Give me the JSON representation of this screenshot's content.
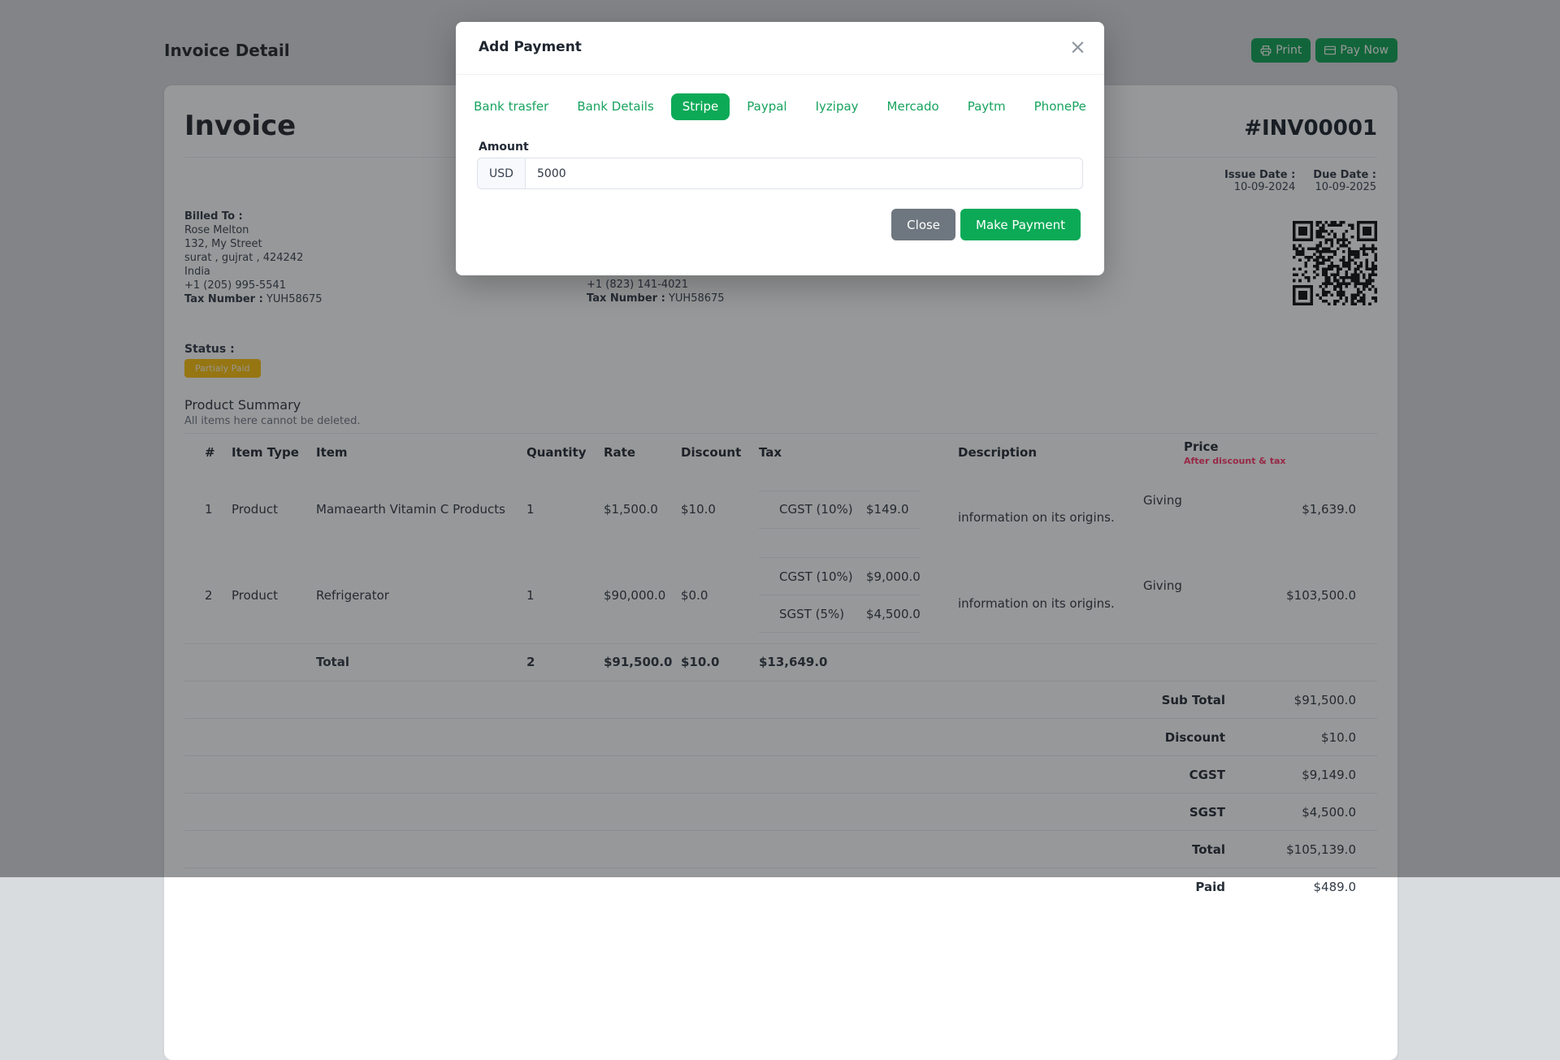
{
  "page": {
    "title": "Invoice Detail",
    "print_label": "Print",
    "pay_now_label": "Pay Now"
  },
  "invoice": {
    "heading": "Invoice",
    "number": "#INV00001",
    "billed_to": {
      "label": "Billed To :",
      "name": "Rose Melton",
      "address1": "132, My Street",
      "address2": "surat , gujrat , 424242",
      "country": "India",
      "phone": "+1 (205) 995-5541",
      "tax_label": "Tax Number :",
      "tax_value": "YUH58675"
    },
    "shipped_to": {
      "phone": "+1 (823) 141-4021",
      "tax_label": "Tax Number :",
      "tax_value": "YUH58675"
    },
    "issue_date_label": "Issue Date :",
    "issue_date": "10-09-2024",
    "due_date_label": "Due Date :",
    "due_date": "10-09-2025",
    "status_label": "Status :",
    "status_badge": "Partialy Paid"
  },
  "product_summary": {
    "title": "Product Summary",
    "subtitle": "All items here cannot be deleted.",
    "columns": {
      "idx": "#",
      "item_type": "Item Type",
      "item": "Item",
      "quantity": "Quantity",
      "rate": "Rate",
      "discount": "Discount",
      "tax": "Tax",
      "description": "Description",
      "price": "Price"
    },
    "price_note": "After discount & tax",
    "rows": [
      {
        "index": "1",
        "item_type": "Product",
        "item": "Mamaearth Vitamin C Products",
        "quantity": "1",
        "rate": "$1,500.0",
        "discount": "$10.0",
        "taxes": [
          {
            "name": "CGST (10%)",
            "amount": "$149.0"
          }
        ],
        "description": "Giving information on its origins.",
        "price": "$1,639.0"
      },
      {
        "index": "2",
        "item_type": "Product",
        "item": "Refrigerator",
        "quantity": "1",
        "rate": "$90,000.0",
        "discount": "$0.0",
        "taxes": [
          {
            "name": "CGST (10%)",
            "amount": "$9,000.0"
          },
          {
            "name": "SGST (5%)",
            "amount": "$4,500.0"
          }
        ],
        "description": "Giving information on its origins.",
        "price": "$103,500.0"
      }
    ],
    "total_row": {
      "label": "Total",
      "quantity": "2",
      "rate": "$91,500.0",
      "discount": "$10.0",
      "tax": "$13,649.0"
    },
    "summary": [
      {
        "label": "Sub Total",
        "value": "$91,500.0"
      },
      {
        "label": "Discount",
        "value": "$10.0"
      },
      {
        "label": "CGST",
        "value": "$9,149.0"
      },
      {
        "label": "SGST",
        "value": "$4,500.0"
      },
      {
        "label": "Total",
        "value": "$105,139.0"
      },
      {
        "label": "Paid",
        "value": "$489.0"
      }
    ]
  },
  "modal": {
    "title": "Add Payment",
    "close_symbol": "×",
    "tabs": [
      {
        "label": "Bank trasfer"
      },
      {
        "label": "Bank Details"
      },
      {
        "label": "Stripe"
      },
      {
        "label": "Paypal"
      },
      {
        "label": "Iyzipay"
      },
      {
        "label": "Mercado"
      },
      {
        "label": "Paytm"
      },
      {
        "label": "PhonePe"
      }
    ],
    "amount_label": "Amount",
    "currency": "USD",
    "amount_value": "5000",
    "close_button": "Close",
    "submit_button": "Make Payment"
  },
  "colors": {
    "accent_green": "#0caa57",
    "warning_badge": "#fdc20f",
    "danger_note": "#ff3a6e"
  }
}
